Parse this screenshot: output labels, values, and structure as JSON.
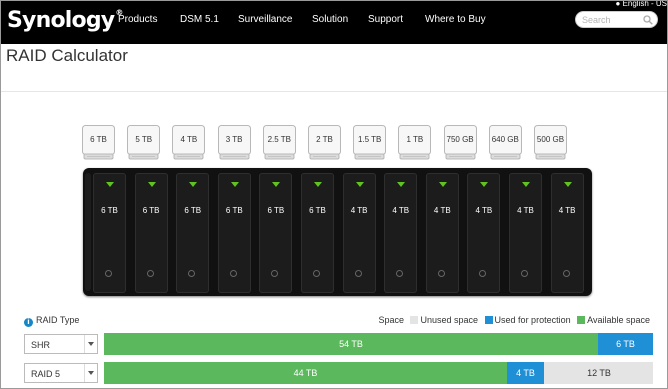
{
  "logo": {
    "text": "Synology",
    "registered": "®"
  },
  "language": "English - US",
  "nav": [
    "Products",
    "DSM 5.1",
    "Surveillance",
    "Solution",
    "Support",
    "Where to Buy"
  ],
  "search": {
    "placeholder": "Search",
    "icon": "search-icon"
  },
  "page_title": "RAID Calculator",
  "disk_pool": [
    "6 TB",
    "5 TB",
    "4 TB",
    "3 TB",
    "2.5 TB",
    "2 TB",
    "1.5 TB",
    "1 TB",
    "750 GB",
    "640 GB",
    "500 GB"
  ],
  "bays": [
    "6 TB",
    "6 TB",
    "6 TB",
    "6 TB",
    "6 TB",
    "6 TB",
    "4 TB",
    "4 TB",
    "4 TB",
    "4 TB",
    "4 TB",
    "4 TB"
  ],
  "raid_type_label": "RAID Type",
  "legend": {
    "title": "Space",
    "unused": "Unused space",
    "protection": "Used for protection",
    "available": "Available space"
  },
  "colors": {
    "available": "#5cb85c",
    "protection": "#1f8fd6",
    "unused": "#e4e4e4",
    "led": "#5fc41f",
    "nav_bg": "#000000"
  },
  "rows": [
    {
      "raid": "SHR",
      "segments": [
        {
          "kind": "available",
          "label": "54 TB",
          "tb": 54
        },
        {
          "kind": "protection",
          "label": "6 TB",
          "tb": 6
        }
      ]
    },
    {
      "raid": "RAID 5",
      "segments": [
        {
          "kind": "available",
          "label": "44 TB",
          "tb": 44
        },
        {
          "kind": "protection",
          "label": "4 TB",
          "tb": 4
        },
        {
          "kind": "unused",
          "label": "12 TB",
          "tb": 12
        }
      ]
    }
  ]
}
